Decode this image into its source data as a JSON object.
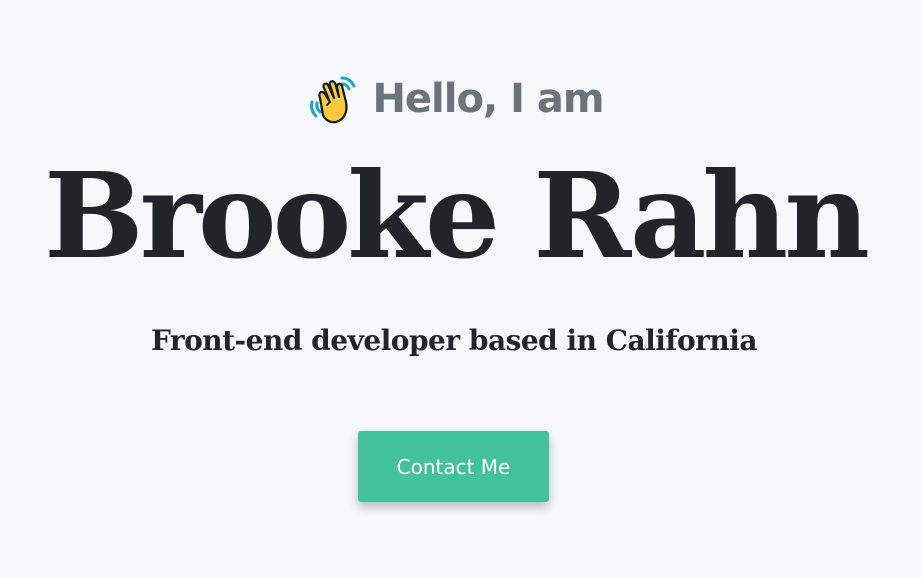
{
  "hero": {
    "greeting_icon": "waving-hand-icon",
    "greeting": "Hello, I am",
    "name": "Brooke Rahn",
    "subtitle": "Front-end developer based in California",
    "cta_label": "Contact Me"
  },
  "colors": {
    "background": "#f7f8fa",
    "greeting": "#6b737c",
    "heading": "#212529",
    "accent": "#41c298",
    "button_text": "#ffffff"
  }
}
